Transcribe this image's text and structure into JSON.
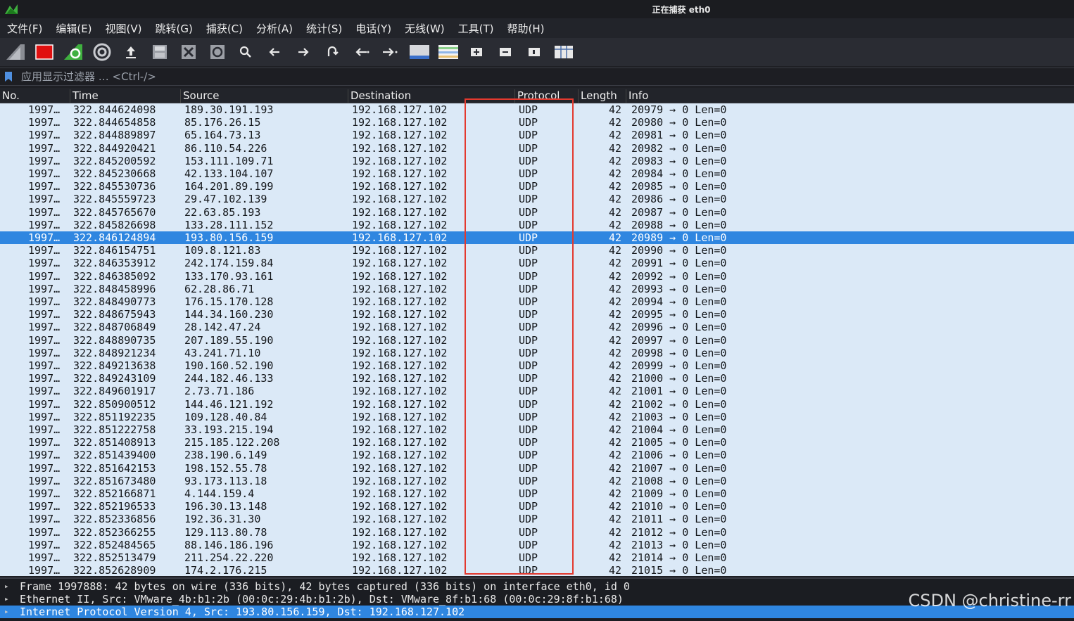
{
  "window": {
    "title": "正在捕获 eth0"
  },
  "menu": [
    "文件(F)",
    "编辑(E)",
    "视图(V)",
    "跳转(G)",
    "捕获(C)",
    "分析(A)",
    "统计(S)",
    "电话(Y)",
    "无线(W)",
    "工具(T)",
    "帮助(H)"
  ],
  "toolbar": {
    "icons": [
      "shark-fin-start-icon",
      "stop-square-icon",
      "restart-capture-icon",
      "capture-options-icon",
      "open-file-icon",
      "save-file-icon",
      "close-file-icon",
      "reload-file-icon",
      "find-packet-icon",
      "go-back-icon",
      "go-forward-icon",
      "go-to-packet-icon",
      "go-first-packet-icon",
      "go-last-packet-icon",
      "autoscroll-icon",
      "colorize-icon",
      "zoom-in-icon",
      "zoom-out-icon",
      "normal-size-icon",
      "resize-columns-icon"
    ]
  },
  "filter": {
    "placeholder": "应用显示过滤器 … <Ctrl-/>",
    "value": ""
  },
  "columns": {
    "no": "No.",
    "time": "Time",
    "source": "Source",
    "destination": "Destination",
    "protocol": "Protocol",
    "length": "Length",
    "info": "Info"
  },
  "packets": [
    {
      "no": "1997…",
      "time": "322.844624098",
      "source": "189.30.191.193",
      "destination": "192.168.127.102",
      "protocol": "UDP",
      "length": "42",
      "info": "20979 → 0 Len=0"
    },
    {
      "no": "1997…",
      "time": "322.844654858",
      "source": "85.176.26.15",
      "destination": "192.168.127.102",
      "protocol": "UDP",
      "length": "42",
      "info": "20980 → 0 Len=0"
    },
    {
      "no": "1997…",
      "time": "322.844889897",
      "source": "65.164.73.13",
      "destination": "192.168.127.102",
      "protocol": "UDP",
      "length": "42",
      "info": "20981 → 0 Len=0"
    },
    {
      "no": "1997…",
      "time": "322.844920421",
      "source": "86.110.54.226",
      "destination": "192.168.127.102",
      "protocol": "UDP",
      "length": "42",
      "info": "20982 → 0 Len=0"
    },
    {
      "no": "1997…",
      "time": "322.845200592",
      "source": "153.111.109.71",
      "destination": "192.168.127.102",
      "protocol": "UDP",
      "length": "42",
      "info": "20983 → 0 Len=0"
    },
    {
      "no": "1997…",
      "time": "322.845230668",
      "source": "42.133.104.107",
      "destination": "192.168.127.102",
      "protocol": "UDP",
      "length": "42",
      "info": "20984 → 0 Len=0"
    },
    {
      "no": "1997…",
      "time": "322.845530736",
      "source": "164.201.89.199",
      "destination": "192.168.127.102",
      "protocol": "UDP",
      "length": "42",
      "info": "20985 → 0 Len=0"
    },
    {
      "no": "1997…",
      "time": "322.845559723",
      "source": "29.47.102.139",
      "destination": "192.168.127.102",
      "protocol": "UDP",
      "length": "42",
      "info": "20986 → 0 Len=0"
    },
    {
      "no": "1997…",
      "time": "322.845765670",
      "source": "22.63.85.193",
      "destination": "192.168.127.102",
      "protocol": "UDP",
      "length": "42",
      "info": "20987 → 0 Len=0"
    },
    {
      "no": "1997…",
      "time": "322.845826698",
      "source": "133.28.111.152",
      "destination": "192.168.127.102",
      "protocol": "UDP",
      "length": "42",
      "info": "20988 → 0 Len=0"
    },
    {
      "no": "1997…",
      "time": "322.846124894",
      "source": "193.80.156.159",
      "destination": "192.168.127.102",
      "protocol": "UDP",
      "length": "42",
      "info": "20989 → 0 Len=0",
      "selected": true
    },
    {
      "no": "1997…",
      "time": "322.846154751",
      "source": "109.8.121.83",
      "destination": "192.168.127.102",
      "protocol": "UDP",
      "length": "42",
      "info": "20990 → 0 Len=0"
    },
    {
      "no": "1997…",
      "time": "322.846353912",
      "source": "242.174.159.84",
      "destination": "192.168.127.102",
      "protocol": "UDP",
      "length": "42",
      "info": "20991 → 0 Len=0"
    },
    {
      "no": "1997…",
      "time": "322.846385092",
      "source": "133.170.93.161",
      "destination": "192.168.127.102",
      "protocol": "UDP",
      "length": "42",
      "info": "20992 → 0 Len=0"
    },
    {
      "no": "1997…",
      "time": "322.848458996",
      "source": "62.28.86.71",
      "destination": "192.168.127.102",
      "protocol": "UDP",
      "length": "42",
      "info": "20993 → 0 Len=0"
    },
    {
      "no": "1997…",
      "time": "322.848490773",
      "source": "176.15.170.128",
      "destination": "192.168.127.102",
      "protocol": "UDP",
      "length": "42",
      "info": "20994 → 0 Len=0"
    },
    {
      "no": "1997…",
      "time": "322.848675943",
      "source": "144.34.160.230",
      "destination": "192.168.127.102",
      "protocol": "UDP",
      "length": "42",
      "info": "20995 → 0 Len=0"
    },
    {
      "no": "1997…",
      "time": "322.848706849",
      "source": "28.142.47.24",
      "destination": "192.168.127.102",
      "protocol": "UDP",
      "length": "42",
      "info": "20996 → 0 Len=0"
    },
    {
      "no": "1997…",
      "time": "322.848890735",
      "source": "207.189.55.190",
      "destination": "192.168.127.102",
      "protocol": "UDP",
      "length": "42",
      "info": "20997 → 0 Len=0"
    },
    {
      "no": "1997…",
      "time": "322.848921234",
      "source": "43.241.71.10",
      "destination": "192.168.127.102",
      "protocol": "UDP",
      "length": "42",
      "info": "20998 → 0 Len=0"
    },
    {
      "no": "1997…",
      "time": "322.849213638",
      "source": "190.160.52.190",
      "destination": "192.168.127.102",
      "protocol": "UDP",
      "length": "42",
      "info": "20999 → 0 Len=0"
    },
    {
      "no": "1997…",
      "time": "322.849243109",
      "source": "244.182.46.133",
      "destination": "192.168.127.102",
      "protocol": "UDP",
      "length": "42",
      "info": "21000 → 0 Len=0"
    },
    {
      "no": "1997…",
      "time": "322.849601917",
      "source": "2.73.71.186",
      "destination": "192.168.127.102",
      "protocol": "UDP",
      "length": "42",
      "info": "21001 → 0 Len=0"
    },
    {
      "no": "1997…",
      "time": "322.850900512",
      "source": "144.46.121.192",
      "destination": "192.168.127.102",
      "protocol": "UDP",
      "length": "42",
      "info": "21002 → 0 Len=0"
    },
    {
      "no": "1997…",
      "time": "322.851192235",
      "source": "109.128.40.84",
      "destination": "192.168.127.102",
      "protocol": "UDP",
      "length": "42",
      "info": "21003 → 0 Len=0"
    },
    {
      "no": "1997…",
      "time": "322.851222758",
      "source": "33.193.215.194",
      "destination": "192.168.127.102",
      "protocol": "UDP",
      "length": "42",
      "info": "21004 → 0 Len=0"
    },
    {
      "no": "1997…",
      "time": "322.851408913",
      "source": "215.185.122.208",
      "destination": "192.168.127.102",
      "protocol": "UDP",
      "length": "42",
      "info": "21005 → 0 Len=0"
    },
    {
      "no": "1997…",
      "time": "322.851439400",
      "source": "238.190.6.149",
      "destination": "192.168.127.102",
      "protocol": "UDP",
      "length": "42",
      "info": "21006 → 0 Len=0"
    },
    {
      "no": "1997…",
      "time": "322.851642153",
      "source": "198.152.55.78",
      "destination": "192.168.127.102",
      "protocol": "UDP",
      "length": "42",
      "info": "21007 → 0 Len=0"
    },
    {
      "no": "1997…",
      "time": "322.851673480",
      "source": "93.173.113.18",
      "destination": "192.168.127.102",
      "protocol": "UDP",
      "length": "42",
      "info": "21008 → 0 Len=0"
    },
    {
      "no": "1997…",
      "time": "322.852166871",
      "source": "4.144.159.4",
      "destination": "192.168.127.102",
      "protocol": "UDP",
      "length": "42",
      "info": "21009 → 0 Len=0"
    },
    {
      "no": "1997…",
      "time": "322.852196533",
      "source": "196.30.13.148",
      "destination": "192.168.127.102",
      "protocol": "UDP",
      "length": "42",
      "info": "21010 → 0 Len=0"
    },
    {
      "no": "1997…",
      "time": "322.852336856",
      "source": "192.36.31.30",
      "destination": "192.168.127.102",
      "protocol": "UDP",
      "length": "42",
      "info": "21011 → 0 Len=0"
    },
    {
      "no": "1997…",
      "time": "322.852366255",
      "source": "129.113.80.78",
      "destination": "192.168.127.102",
      "protocol": "UDP",
      "length": "42",
      "info": "21012 → 0 Len=0"
    },
    {
      "no": "1997…",
      "time": "322.852484565",
      "source": "88.146.186.196",
      "destination": "192.168.127.102",
      "protocol": "UDP",
      "length": "42",
      "info": "21013 → 0 Len=0"
    },
    {
      "no": "1997…",
      "time": "322.852513479",
      "source": "211.254.22.220",
      "destination": "192.168.127.102",
      "protocol": "UDP",
      "length": "42",
      "info": "21014 → 0 Len=0"
    },
    {
      "no": "1997…",
      "time": "322.852628909",
      "source": "174.2.176.215",
      "destination": "192.168.127.102",
      "protocol": "UDP",
      "length": "42",
      "info": "21015 → 0 Len=0"
    }
  ],
  "details": [
    {
      "text": "Frame 1997888: 42 bytes on wire (336 bits), 42 bytes captured (336 bits) on interface eth0, id 0",
      "selected": false
    },
    {
      "text": "Ethernet II, Src: VMware_4b:b1:2b (00:0c:29:4b:b1:2b), Dst: VMware_8f:b1:68 (00:0c:29:8f:b1:68)",
      "selected": false
    },
    {
      "text": "Internet Protocol Version 4, Src: 193.80.156.159, Dst: 192.168.127.102",
      "selected": true
    }
  ],
  "watermark": "CSDN @christine-rr",
  "colors": {
    "list_bg": "#dbe9f7",
    "selected": "#2f86e0",
    "annotation": "#e3392e",
    "stop": "#e01010",
    "restart": "#3fb03f"
  }
}
